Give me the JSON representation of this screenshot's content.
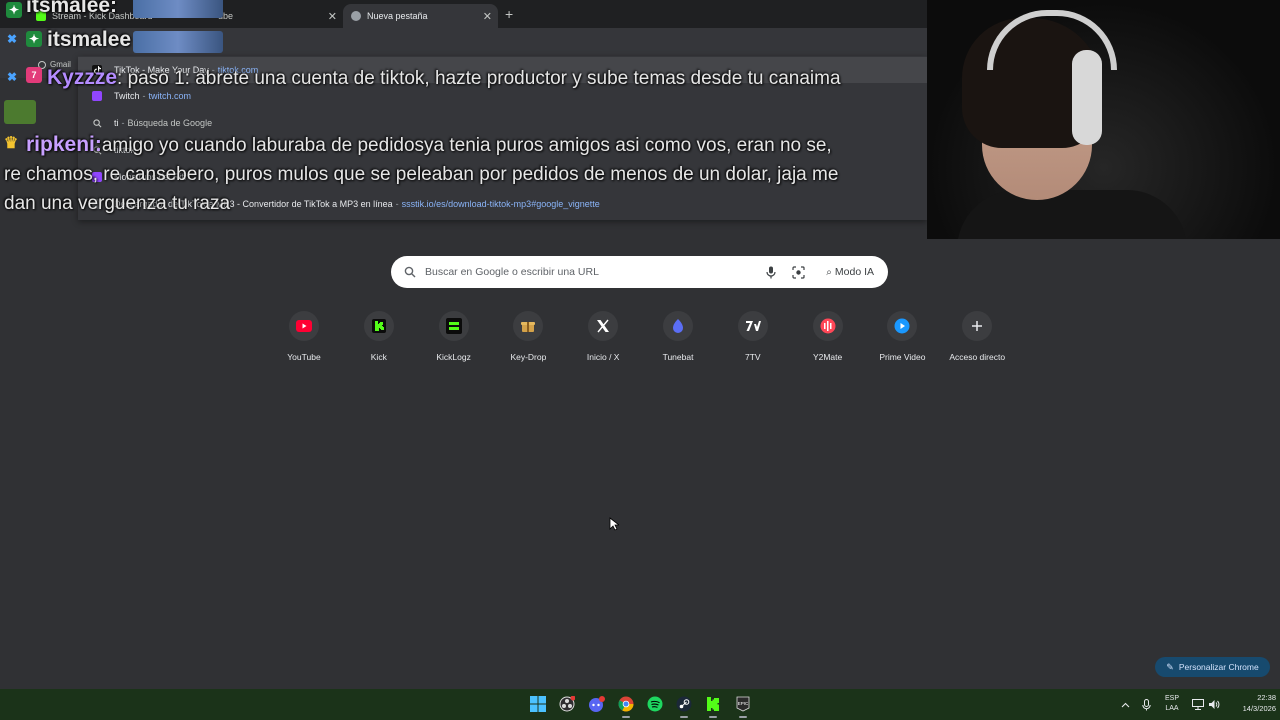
{
  "browser": {
    "tabs": [
      {
        "title": "Stream - Kick Dashboard",
        "active": false
      },
      {
        "title": "ube",
        "active": false
      },
      {
        "title": "Nueva pestaña",
        "active": true
      }
    ],
    "new_tab_symbol": "+",
    "bookmark_gmail": "Gmail"
  },
  "omnibox_dropdown": {
    "rows": [
      {
        "title": "TikTok - Make Your Day",
        "sep": "-",
        "url": "tiktok.com",
        "icon": "tiktok-icon",
        "selected": true
      },
      {
        "title": "Twitch",
        "sep": "-",
        "url": "twitch.com",
        "icon": "twitch-icon",
        "selected": false
      },
      {
        "title": "ti",
        "sep": "-",
        "url": "Búsqueda de Google",
        "icon": "search-icon",
        "selected": false
      },
      {
        "title": "tiktok",
        "sep": "",
        "url": "",
        "icon": "search-icon",
        "selected": false
      },
      {
        "title": "Monstruos del Riff",
        "sep": "-",
        "url": "",
        "icon": "twitch-icon",
        "selected": false
      },
      {
        "title": "Descargador de TikTok a MP3 - Convertidor de TikTok a MP3 en línea",
        "sep": "-",
        "url": "ssstik.io/es/download-tiktok-mp3#google_vignette",
        "icon": "web-icon",
        "selected": false
      }
    ]
  },
  "chat": {
    "messages": [
      {
        "user": "itsmalee:",
        "text": "",
        "color": "#ffffff"
      },
      {
        "user": "itsmalee",
        "text": "",
        "color": "#ffffff"
      },
      {
        "user": "Kyzzze",
        "text": ": paso 1: abrete una cuenta de tiktok, hazte productor y sube temas desde tu canaima",
        "color": "#b48cff"
      },
      {
        "user": "ripkeni:",
        "text": "amigo yo cuando laburaba de pedidosya tenia puros amigos asi como vos, eran no se,",
        "color": "#c8a0ff"
      },
      {
        "user": "",
        "text": "re chamos, re cansebero, puros mulos que se peleaban por pedidos de menos de un dolar, jaja me",
        "color": ""
      },
      {
        "user": "",
        "text": "dan una verguenza tu raza",
        "color": ""
      }
    ]
  },
  "search": {
    "placeholder": "Buscar en Google o escribir una URL",
    "ai_mode_label": "Modo IA"
  },
  "shortcuts": [
    {
      "label": "YouTube",
      "icon": "youtube-icon",
      "color": "#ff0033"
    },
    {
      "label": "Kick",
      "icon": "kick-icon",
      "color": "#53fc18"
    },
    {
      "label": "KickLogz",
      "icon": "kicklogz-icon",
      "color": "#53fc18"
    },
    {
      "label": "Key-Drop",
      "icon": "keydrop-icon",
      "color": "#d4a24a"
    },
    {
      "label": "Inicio / X",
      "icon": "x-icon",
      "color": "#ffffff"
    },
    {
      "label": "Tunebat",
      "icon": "tunebat-icon",
      "color": "#5b6ef5"
    },
    {
      "label": "7TV",
      "icon": "7tv-icon",
      "color": "#ffffff"
    },
    {
      "label": "Y2Mate",
      "icon": "y2mate-icon",
      "color": "#ff4757"
    },
    {
      "label": "Prime Video",
      "icon": "primevideo-icon",
      "color": "#1a98ff"
    },
    {
      "label": "Acceso directo",
      "icon": "add-icon",
      "color": "#e8eaed"
    }
  ],
  "customize_label": "Personalizar Chrome",
  "taskbar": {
    "language_line1": "ESP",
    "language_line2": "LAA",
    "time": "22:38",
    "date": "14/3/2026"
  }
}
